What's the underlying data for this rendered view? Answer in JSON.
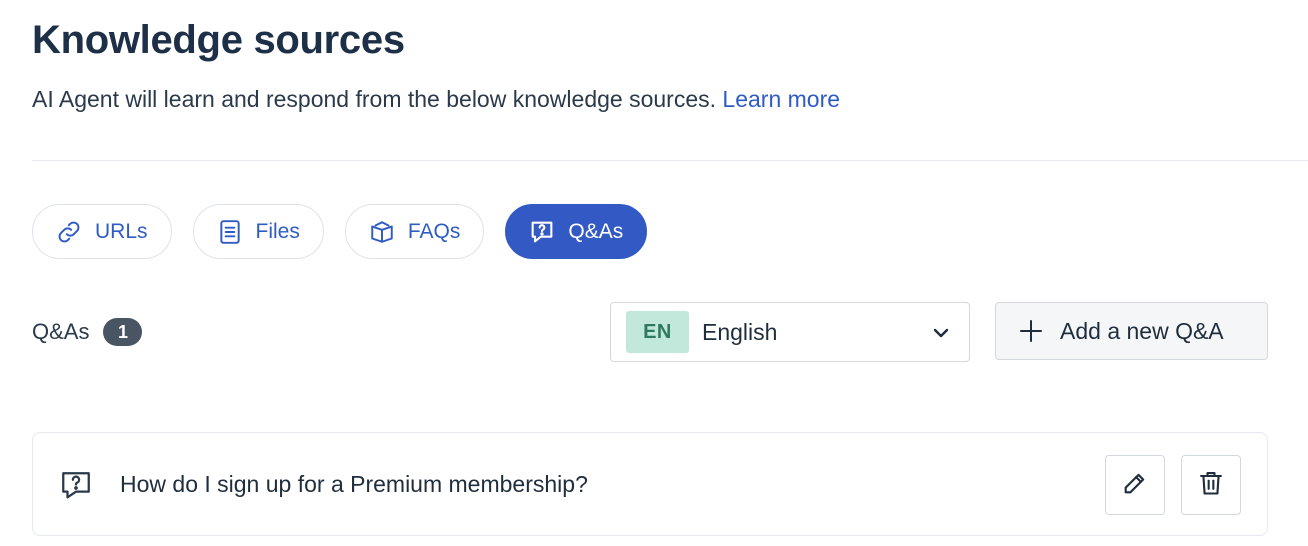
{
  "header": {
    "title": "Knowledge sources",
    "subtitle": "AI Agent will learn and respond from the below knowledge sources.",
    "learn_more": "Learn more"
  },
  "tabs": [
    {
      "label": "URLs",
      "icon": "link-icon",
      "active": false
    },
    {
      "label": "Files",
      "icon": "file-icon",
      "active": false
    },
    {
      "label": "FAQs",
      "icon": "book-icon",
      "active": false
    },
    {
      "label": "Q&As",
      "icon": "question-chat-icon",
      "active": true
    }
  ],
  "toolbar": {
    "section_label": "Q&As",
    "count": "1",
    "language": {
      "code": "EN",
      "name": "English"
    },
    "add_label": "Add a new Q&A"
  },
  "qa_items": [
    {
      "question": "How do I sign up for a Premium membership?"
    }
  ],
  "colors": {
    "accent": "#3359c4",
    "link": "#2f5cc4",
    "badge": "#4a5563",
    "lang_badge_bg": "#c2e8dc",
    "lang_badge_text": "#2d7a5f"
  }
}
